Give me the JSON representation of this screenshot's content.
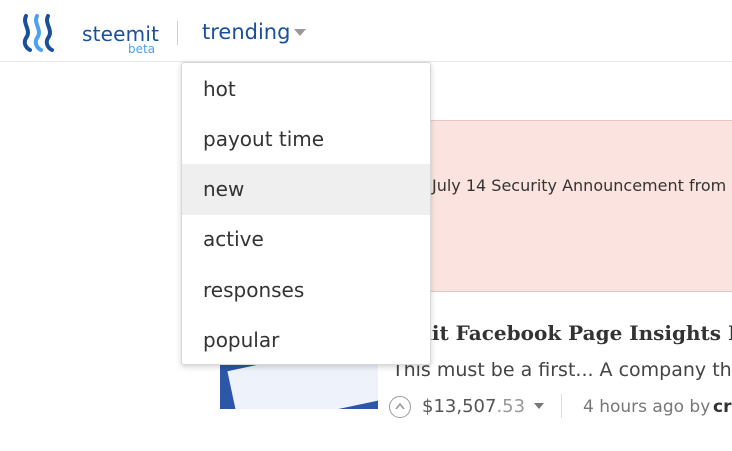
{
  "header": {
    "brand": "steemit",
    "brand_sub": "beta",
    "nav_label": "trending"
  },
  "sort_menu": {
    "items": [
      {
        "label": "hot"
      },
      {
        "label": "payout time"
      },
      {
        "label": "new",
        "highlighted": true
      },
      {
        "label": "active"
      },
      {
        "label": "responses"
      },
      {
        "label": "popular"
      }
    ]
  },
  "announcement": {
    "text": "July 14 Security Announcement from"
  },
  "post": {
    "title": "emit Facebook Page Insights I",
    "excerpt": "This must be a first... A company tha",
    "payout_whole": "$13,507",
    "payout_cents": ".53",
    "time": "4 hours ago by",
    "author": "cr"
  },
  "colors": {
    "brand_blue": "#1a5099",
    "beta_blue": "#4ba2f2",
    "announce_bg": "#fbe4e0",
    "menu_highlight": "#efefef"
  },
  "icons": {
    "logo": "steemit-logo-icon",
    "nav_caret": "chevron-down-icon",
    "upvote": "upvote-icon",
    "payout_caret": "chevron-down-icon"
  }
}
